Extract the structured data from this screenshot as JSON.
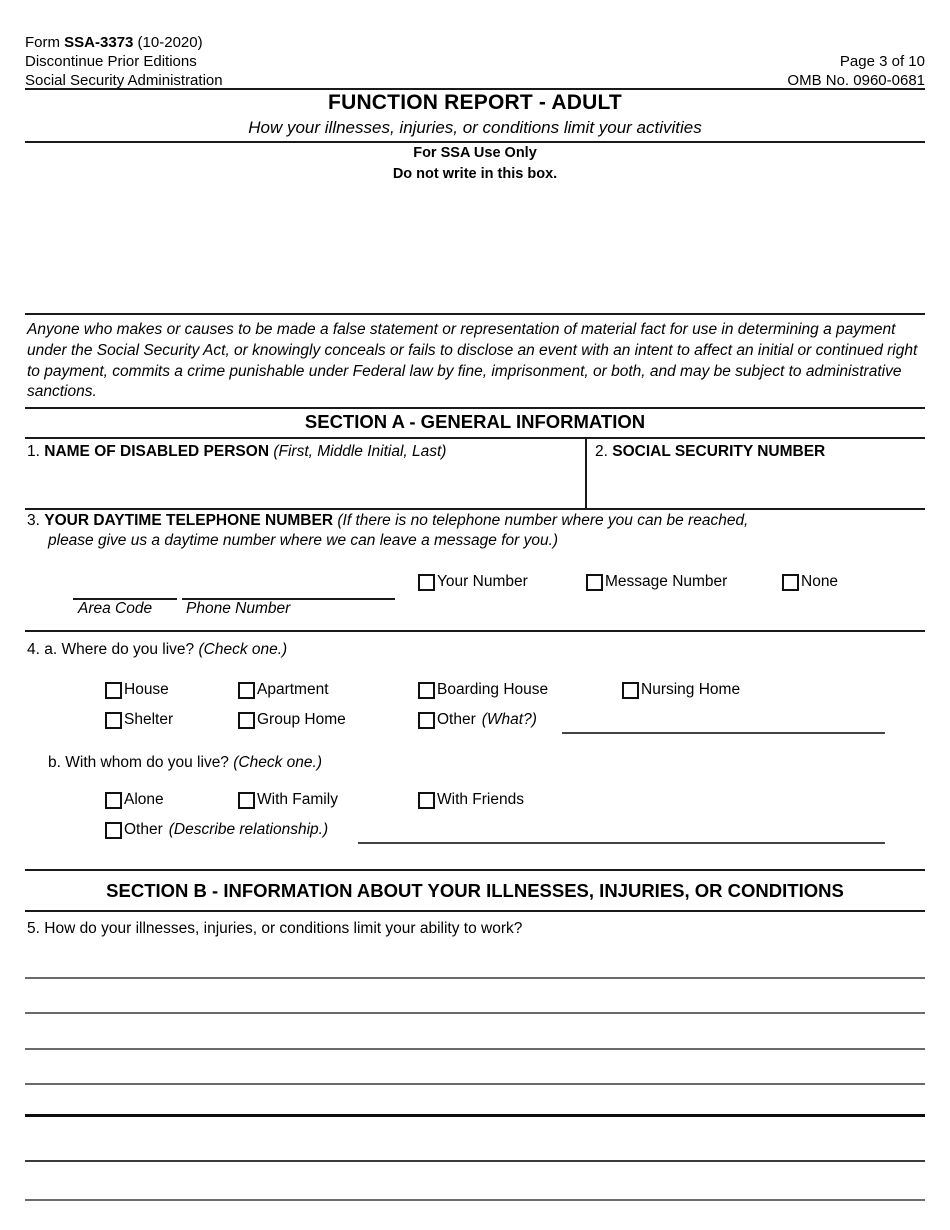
{
  "header": {
    "form_line_prefix": "Form ",
    "form_number": "SSA-3373",
    "form_line_suffix": " (10-2020)",
    "discontinue": "Discontinue Prior Editions",
    "agency": "Social Security Administration",
    "page_label": "Page 3 of 10",
    "omb_label": "OMB  No. 0960-0681"
  },
  "title": {
    "main": "FUNCTION REPORT - ADULT",
    "subtitle": "How your illnesses, injuries, or conditions limit your activities"
  },
  "ssa_box": {
    "line1": "For SSA Use Only",
    "line2": "Do not write in this box."
  },
  "penalty": {
    "text": "Anyone who makes or causes to be made a false  statement or representation of material fact for use in determining a payment under the Social Security Act, or knowingly conceals or fails to disclose an event with an intent to affect an initial or continued right to payment, commits a crime punishable under Federal law by fine, imprisonment, or both, and may be subject to  administrative sanctions."
  },
  "section_a": {
    "heading": "SECTION A - GENERAL INFORMATION",
    "q1": {
      "number": "1.",
      "label": "NAME OF DISABLED PERSON",
      "hint": "(First, Middle Initial, Last)",
      "value": ""
    },
    "q2": {
      "number": "2.",
      "label": "SOCIAL SECURITY NUMBER",
      "value": ""
    },
    "q3": {
      "number": "3.",
      "label": "YOUR DAYTIME TELEPHONE NUMBER",
      "hint_line1": "(If there is no telephone number where you can be reached,",
      "hint_line2": "please give us a daytime number where we can leave a message for you.)",
      "area_code_label": "Area Code",
      "area_code_value": "",
      "phone_label": "Phone Number",
      "phone_value": "",
      "options": [
        {
          "label": "Your Number",
          "checked": false
        },
        {
          "label": "Message Number",
          "checked": false
        },
        {
          "label": "None",
          "checked": false
        }
      ]
    },
    "q4a": {
      "number": "4. a.",
      "label": "Where do you live?",
      "hint": "(Check one.)",
      "options": [
        {
          "label": "House",
          "checked": false
        },
        {
          "label": "Apartment",
          "checked": false
        },
        {
          "label": "Boarding House",
          "checked": false
        },
        {
          "label": "Nursing Home",
          "checked": false
        },
        {
          "label": "Shelter",
          "checked": false
        },
        {
          "label": "Group Home",
          "checked": false
        },
        {
          "label": "Other",
          "hint": "(What?)",
          "checked": false
        }
      ],
      "other_value": ""
    },
    "q4b": {
      "number": "b.",
      "label": "With whom do you live?",
      "hint": "(Check one.)",
      "options": [
        {
          "label": "Alone",
          "checked": false
        },
        {
          "label": "With Family",
          "checked": false
        },
        {
          "label": "With Friends",
          "checked": false
        },
        {
          "label": "Other",
          "hint": "(Describe relationship.)",
          "checked": false
        }
      ],
      "other_value": ""
    }
  },
  "section_b": {
    "heading": "SECTION B - INFORMATION ABOUT YOUR ILLNESSES, INJURIES, OR CONDITIONS",
    "q5": {
      "number": "5.",
      "label": "How do your illnesses, injuries, or conditions limit your ability to work?",
      "answer_lines": [
        "",
        "",
        "",
        "",
        "",
        "",
        ""
      ]
    }
  }
}
